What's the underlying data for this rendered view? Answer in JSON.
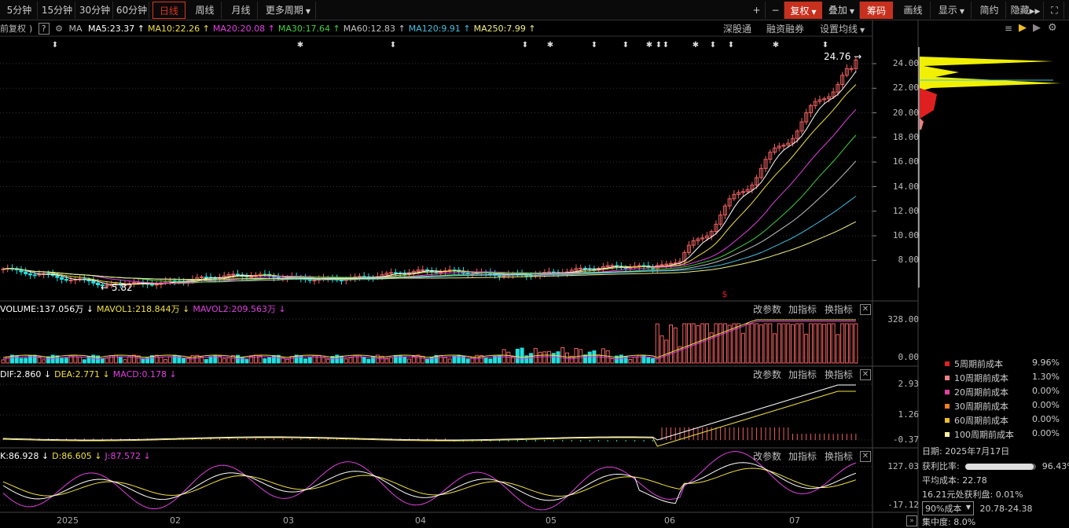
{
  "toolbar": {
    "periods": [
      "5分钟",
      "15分钟",
      "30分钟",
      "60分钟",
      "日线",
      "周线",
      "月线",
      "更多周期"
    ],
    "active_period": "日线",
    "right_buttons": [
      "+",
      "−",
      "复权",
      "叠加",
      "筹码",
      "画线",
      "显示",
      "简约",
      "隐藏"
    ],
    "fuquan": "复权",
    "chouma": "筹码"
  },
  "main_panel": {
    "adjust_label": "前复权",
    "ma_label": "MA",
    "ma": [
      {
        "text": "MA5:23.37",
        "color": "#ffffff"
      },
      {
        "text": "MA10:22.26",
        "color": "#f0e040"
      },
      {
        "text": "MA20:20.08",
        "color": "#e040e0"
      },
      {
        "text": "MA30:17.64",
        "color": "#40d040"
      },
      {
        "text": "MA60:12.83",
        "color": "#c0c0c0"
      },
      {
        "text": "MA120:9.91",
        "color": "#40c0e0"
      },
      {
        "text": "MA250:7.99",
        "color": "#f0f080"
      }
    ],
    "links": [
      "深股通",
      "融资融券",
      "设置均线"
    ],
    "high_label": "24.76",
    "low_label": "5.82",
    "y_ticks": [
      "24.00",
      "22.00",
      "20.00",
      "18.00",
      "16.00",
      "14.00",
      "12.00",
      "10.00",
      "8.00"
    ]
  },
  "volume_panel": {
    "values": [
      {
        "text": "VOLUME:137.056万",
        "color": "#ffffff"
      },
      {
        "text": "MAVOL1:218.844万",
        "color": "#f0e040"
      },
      {
        "text": "MAVOL2:209.563万",
        "color": "#e040e0"
      }
    ],
    "buttons": [
      "改参数",
      "加指标",
      "换指标"
    ],
    "y_ticks": [
      "328.00",
      "0.00"
    ]
  },
  "macd_panel": {
    "values": [
      {
        "text": "DIF:2.860",
        "color": "#ffffff"
      },
      {
        "text": "DEA:2.771",
        "color": "#f0e040"
      },
      {
        "text": "MACD:0.178",
        "color": "#e040e0"
      }
    ],
    "buttons": [
      "改参数",
      "加指标",
      "换指标"
    ],
    "y_ticks": [
      "2.93",
      "1.26",
      "-0.37"
    ]
  },
  "kdj_panel": {
    "values": [
      {
        "text": "K:86.928",
        "color": "#ffffff"
      },
      {
        "text": "D:86.605",
        "color": "#f0e040"
      },
      {
        "text": "J:87.572",
        "color": "#e040e0"
      }
    ],
    "buttons": [
      "改参数",
      "加指标",
      "换指标"
    ],
    "y_ticks": [
      "127.03",
      "-17.12"
    ]
  },
  "x_axis": [
    "2025",
    "02",
    "03",
    "04",
    "05",
    "06",
    "07"
  ],
  "cost_panel": {
    "legend": [
      {
        "name": "5周期前成本",
        "value": "9.96%",
        "color": "#e02020"
      },
      {
        "name": "10周期前成本",
        "value": "1.30%",
        "color": "#f08080"
      },
      {
        "name": "20周期前成本",
        "value": "0.00%",
        "color": "#e040a0"
      },
      {
        "name": "30周期前成本",
        "value": "0.00%",
        "color": "#f08020"
      },
      {
        "name": "60周期前成本",
        "value": "0.00%",
        "color": "#f0c020"
      },
      {
        "name": "100周期前成本",
        "value": "0.00%",
        "color": "#fff0a0"
      }
    ],
    "date": "日期: 2025年7月17日",
    "profit_label": "获利比率:",
    "profit_ratio": "96.43%",
    "profit_fraction": 0.9643,
    "avg_cost": "平均成本: 22.78",
    "profit_at": "16.21元处获利盘: 0.01%",
    "cost_select": "90%成本",
    "cost_range": "20.78-24.38",
    "concentration": "集中度: 8.0%"
  }
}
